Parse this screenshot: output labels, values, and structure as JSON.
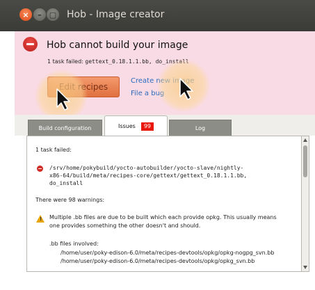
{
  "window": {
    "title": "Hob - Image creator",
    "close_glyph": "×",
    "min_glyph": "–",
    "max_glyph": "▢"
  },
  "infobar": {
    "heading": "Hob cannot build your image",
    "fail_label": "1 task failed:",
    "fail_task": "gettext_0.18.1.1.bb, do_install",
    "edit_button": "Edit recipes",
    "create_link": "Create new image",
    "bug_link": "File a bug"
  },
  "tabs": {
    "build": "Build configuration",
    "issues": "Issues",
    "issues_count": "99",
    "log": "Log"
  },
  "issues": {
    "summary": "1 task failed:",
    "error_line1": "/srv/home/pokybuild/yocto-autobuilder/yocto-slave/nightly-",
    "error_line2": "x86-64/build/meta/recipes-core/gettext/gettext_0.18.1.1.bb,",
    "error_line3": "do_install",
    "warnings_summary": "There were 98 warnings:",
    "warn_line1": "Multiple .bb files are due to be built which each provide opkg. This usually means",
    "warn_line2": "one provides something the other doesn't and should.",
    "files_label": ".bb files involved:",
    "file1": "/home/user/poky-edison-6.0/meta/recipes-devtools/opkg/opkg-nogpg_svn.bb",
    "file2": "/home/user/poky-edison-6.0/meta/recipes-devtools/opkg/opkg_svn.bb"
  },
  "icons": {
    "window_close": "close-icon",
    "window_minimize": "minimize-icon",
    "window_maximize": "maximize-icon",
    "error": "error-icon",
    "warning": "warning-icon",
    "cursor": "mouse-pointer-icon"
  },
  "colors": {
    "infobar_bg": "#f9dbe6",
    "accent_button": "#e0703f",
    "link": "#2a6bbd",
    "badge": "#e8160b",
    "error": "#d22a25",
    "warning": "#e5a50a"
  }
}
